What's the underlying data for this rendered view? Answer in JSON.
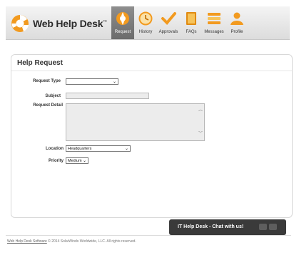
{
  "header": {
    "brand": "Web Help Desk",
    "trademark": "™",
    "nav": [
      {
        "label": "Request",
        "icon": "request-icon",
        "active": true
      },
      {
        "label": "History",
        "icon": "clock-icon",
        "active": false
      },
      {
        "label": "Approvals",
        "icon": "checkmark-icon",
        "active": false
      },
      {
        "label": "FAQs",
        "icon": "book-icon",
        "active": false
      },
      {
        "label": "Messages",
        "icon": "messages-icon",
        "active": false
      },
      {
        "label": "Profile",
        "icon": "user-icon",
        "active": false
      }
    ]
  },
  "form": {
    "title": "Help Request",
    "request_type_label": "Request Type",
    "request_type_value": "",
    "subject_label": "Subject",
    "subject_value": "",
    "detail_label": "Request Detail",
    "detail_value": "",
    "location_label": "Location",
    "location_value": "Headquarters",
    "priority_label": "Priority",
    "priority_value": "Medium"
  },
  "footer": {
    "link_text": "Web Help Desk Software",
    "rest_text": " © 2014 SolarWinds Worldwide, LLC. All rights reserved."
  },
  "chat": {
    "label": "IT Help Desk - Chat with us!"
  },
  "colors": {
    "accent_orange": "#f29a1f",
    "active_tab": "#7a7a7a",
    "chat_bg": "#3a3a3a"
  }
}
